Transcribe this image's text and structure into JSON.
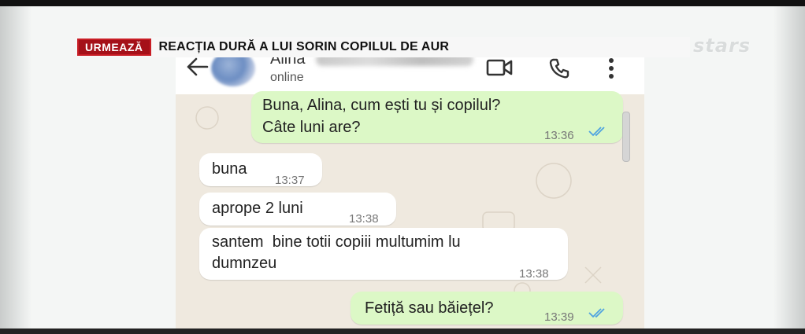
{
  "ticker": {
    "tag": "URMEAZĂ",
    "headline": "REACȚIA DURĂ A LUI SORIN COPILUL DE AUR"
  },
  "channel_logo": "stars",
  "chat": {
    "contact_name": "Alina",
    "status": "online",
    "messages": [
      {
        "direction": "out",
        "line1": "Buna, Alina, cum ești tu și copilul?",
        "line2": "Câte luni are?",
        "time": "13:36",
        "read": true
      },
      {
        "direction": "in",
        "text": "buna",
        "time": "13:37"
      },
      {
        "direction": "in",
        "text": "aprope 2 luni",
        "time": "13:38"
      },
      {
        "direction": "in",
        "line1": "santem  bine totii copiii multumim lu",
        "line2": "dumnzeu",
        "time": "13:38"
      },
      {
        "direction": "out",
        "text": "Fetiță sau băiețel?",
        "time": "13:39",
        "read": true
      }
    ]
  },
  "icons": [
    "back-arrow-icon",
    "video-call-icon",
    "phone-call-icon",
    "more-options-icon",
    "double-check-icon"
  ],
  "colors": {
    "outgoing_bubble": "#dcf8c6",
    "incoming_bubble": "#ffffff",
    "read_ticks": "#4fa3e0",
    "ticker_tag": "#a51119"
  }
}
